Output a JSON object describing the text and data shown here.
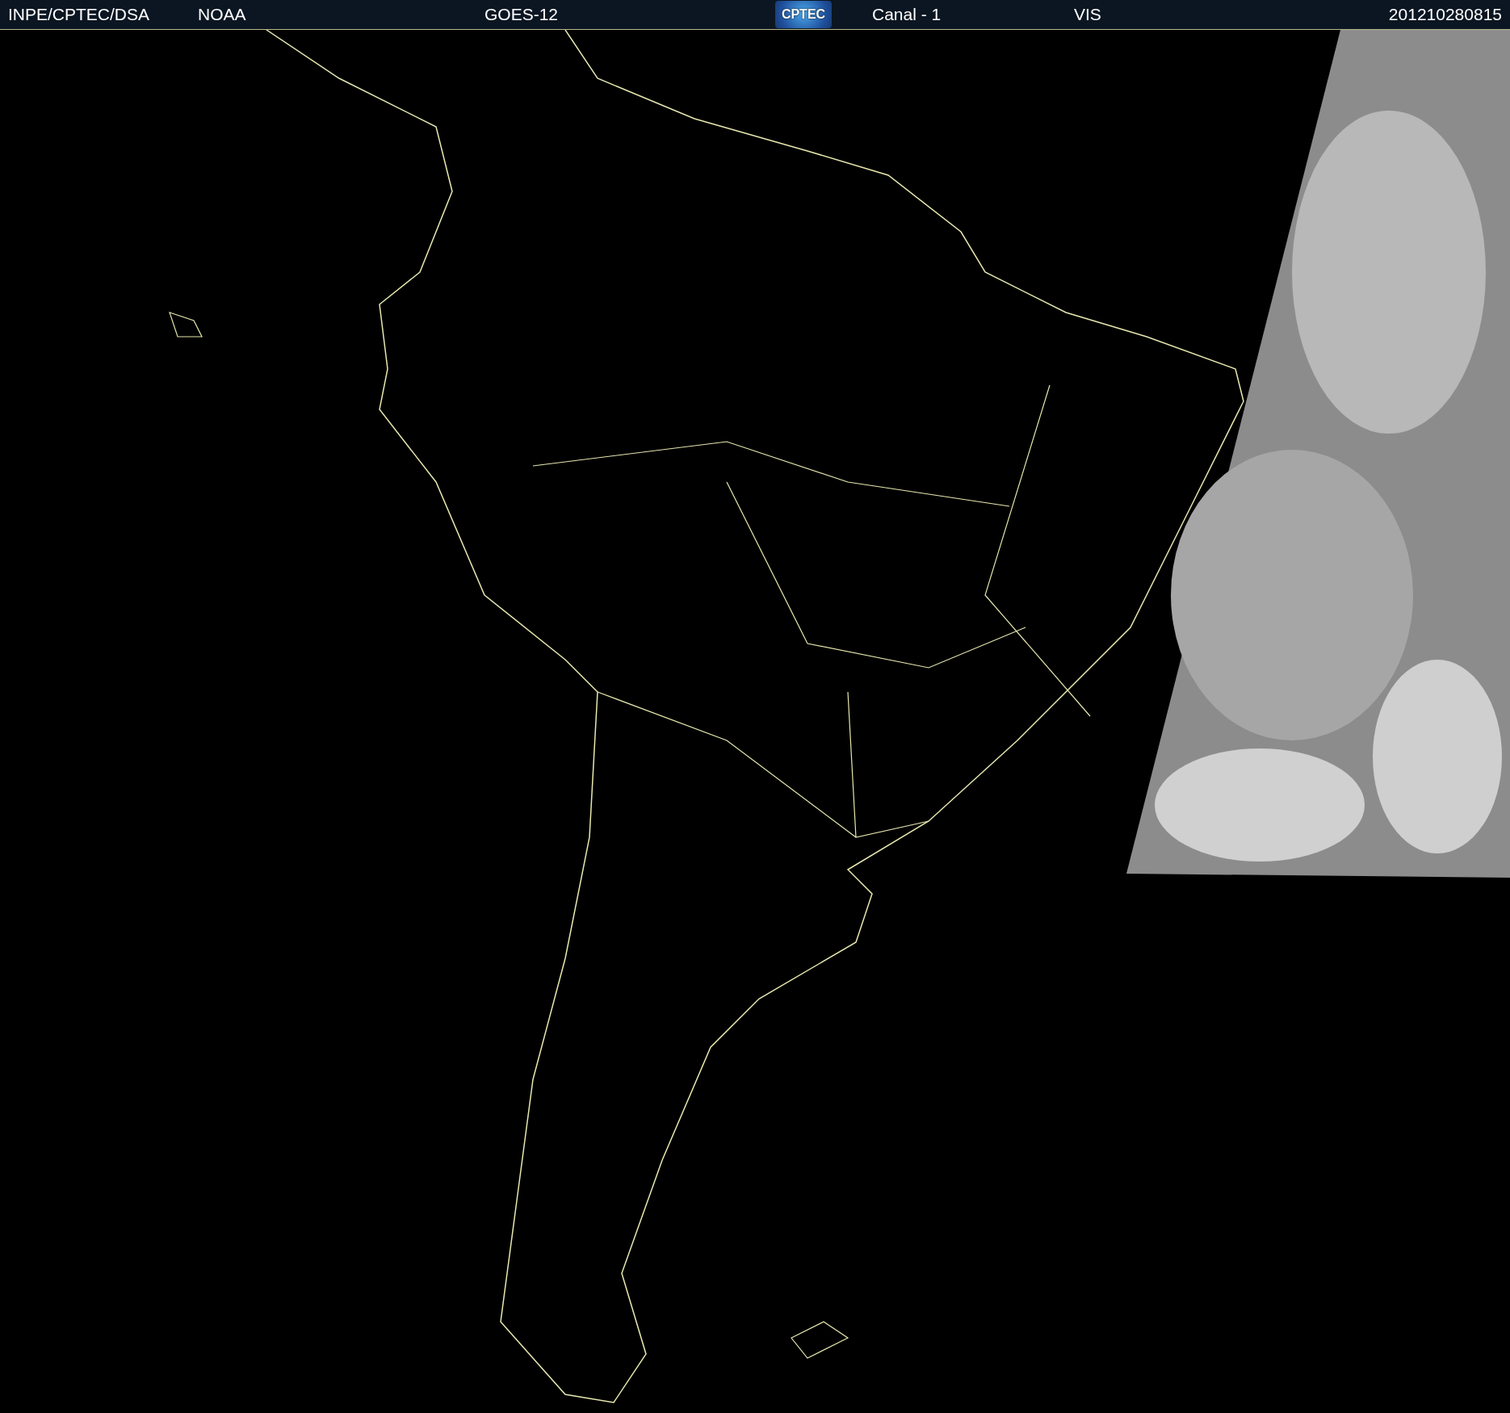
{
  "header": {
    "source": "INPE/CPTEC/DSA",
    "agency": "NOAA",
    "satellite": "GOES-12",
    "logo": "CPTEC",
    "channel": "Canal - 1",
    "band": "VIS",
    "timestamp": "201210280815"
  }
}
